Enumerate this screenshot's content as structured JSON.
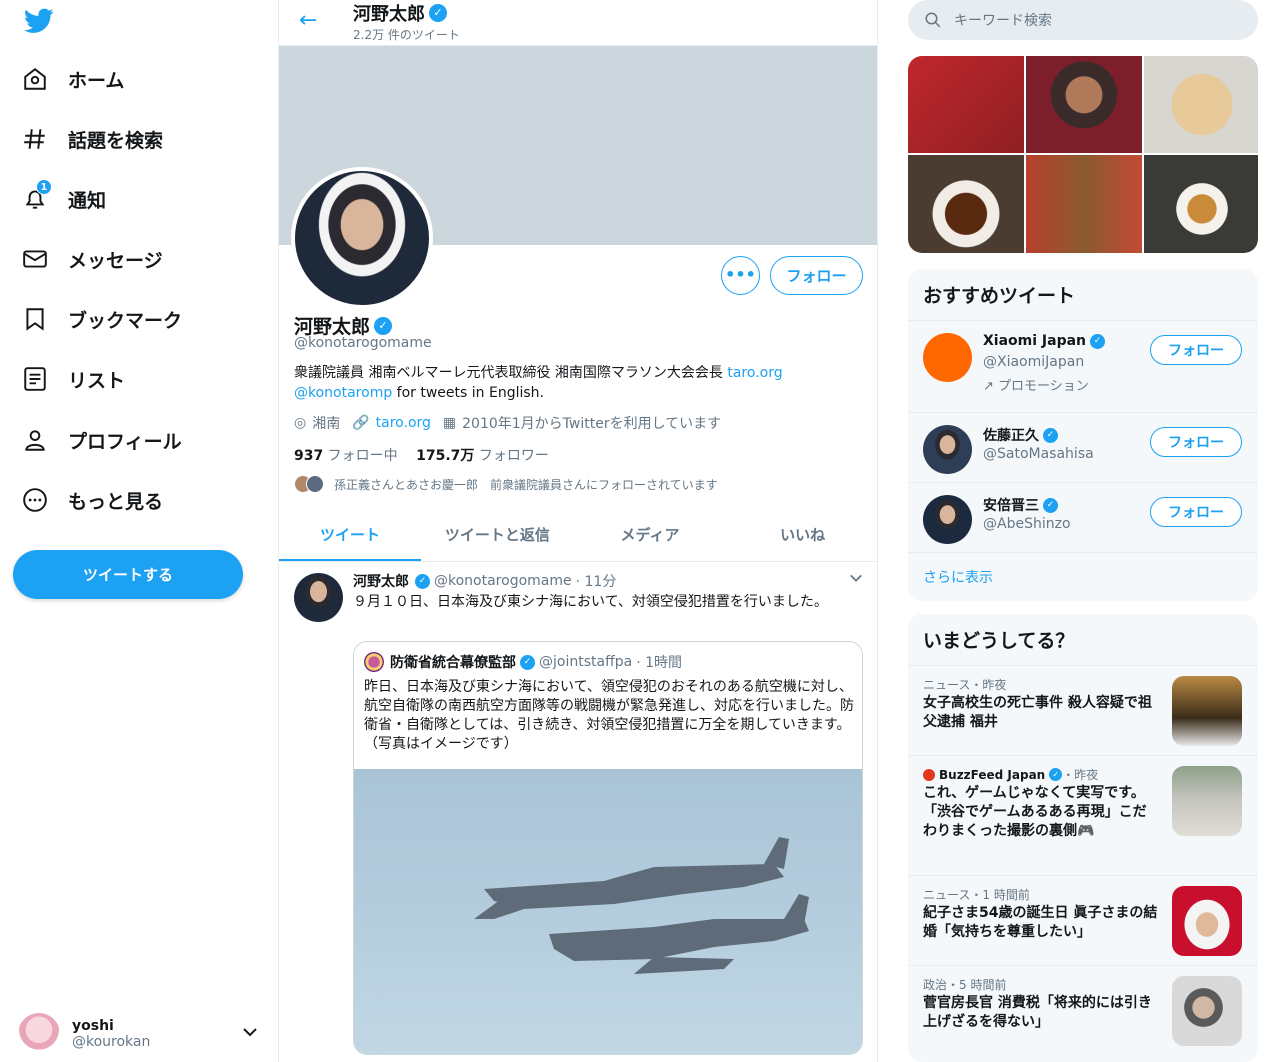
{
  "nav": {
    "items": [
      {
        "label": "ホーム",
        "icon": "home-icon"
      },
      {
        "label": "話題を検索",
        "icon": "hashtag-icon"
      },
      {
        "label": "通知",
        "icon": "bell-icon",
        "badge": "1"
      },
      {
        "label": "メッセージ",
        "icon": "mail-icon"
      },
      {
        "label": "ブックマーク",
        "icon": "bookmark-icon"
      },
      {
        "label": "リスト",
        "icon": "list-icon"
      },
      {
        "label": "プロフィール",
        "icon": "person-icon"
      },
      {
        "label": "もっと見る",
        "icon": "more-icon"
      }
    ],
    "tweet_button": "ツイートする",
    "account": {
      "name": "yoshi",
      "handle": "@kourokan"
    }
  },
  "header": {
    "title": "河野太郎",
    "tweet_count": "2.2万 件のツイート"
  },
  "profile": {
    "name": "河野太郎",
    "handle": "@konotarogomame",
    "bio_text1": "衆議院議員 湘南ベルマーレ元代表取締役 湘南国際マラソン大会会長 ",
    "bio_link1": "taro.org",
    "bio_link2": "@konotaromp",
    "bio_text2": " for tweets in English.",
    "location": "湘南",
    "website": "taro.org",
    "joined": "2010年1月からTwitterを利用しています",
    "following_count": "937",
    "following_label": " フォロー中",
    "followers_count": "175.7万",
    "followers_label": " フォロワー",
    "followed_by": "孫正義さんとあさお慶一郎　前衆議院議員さんにフォローされています",
    "follow_button": "フォロー",
    "more_button": "•••"
  },
  "tabs": [
    "ツイート",
    "ツイートと返信",
    "メディア",
    "いいね"
  ],
  "tweet": {
    "name": "河野太郎",
    "handle": "@konotarogomame",
    "time": "· 11分",
    "text": "９月１０日、日本海及び東シナ海において、対領空侵犯措置を行いました。",
    "quote": {
      "name": "防衛省統合幕僚監部",
      "handle": "@jointstaffpa",
      "time": "· 1時間",
      "text": "昨日、日本海及び東シナ海において、領空侵犯のおそれのある航空機に対し、航空自衛隊の南西航空方面隊等の戦闘機が緊急発進し、対応を行いました。防衛省・自衛隊としては、引き続き、対領空侵犯措置に万全を期していきます。（写真はイメージです）"
    }
  },
  "search": {
    "placeholder": "キーワード検索"
  },
  "recommend": {
    "title": "おすすめツイート",
    "users": [
      {
        "name": "Xiaomi Japan",
        "handle": "@XiaomiJapan",
        "follow": "フォロー",
        "promo": "プロモーション",
        "avatar_color": "#ff6700"
      },
      {
        "name": "佐藤正久",
        "handle": "@SatoMasahisa",
        "follow": "フォロー",
        "avatar_color": "#2d3e56"
      },
      {
        "name": "安倍晋三",
        "handle": "@AbeShinzo",
        "follow": "フォロー",
        "avatar_color": "#1c2a40"
      }
    ],
    "show_more": "さらに表示"
  },
  "trends": {
    "title": "いまどうしてる？",
    "items": [
      {
        "category": "ニュース・昨夜",
        "text": "女子高校生の死亡事件 殺人容疑で祖父逮捕 福井"
      },
      {
        "category": "BuzzFeed Japan",
        "category_suffix": "・昨夜",
        "text": "これ、ゲームじゃなくて実写です。「渋谷でゲームあるある再現」こだわりまくった撮影の裏側🎮"
      },
      {
        "category": "ニュース・1 時間前",
        "text": "紀子さま54歳の誕生日 眞子さまの結婚「気持ちを尊重したい」"
      },
      {
        "category": "政治・5 時間前",
        "text": "菅官房長官 消費税「将来的には引き上げざるを得ない」"
      }
    ]
  },
  "colors": {
    "accent": "#1da1f2",
    "text": "#14171a",
    "muted": "#657786",
    "border": "#e6ecf0"
  }
}
